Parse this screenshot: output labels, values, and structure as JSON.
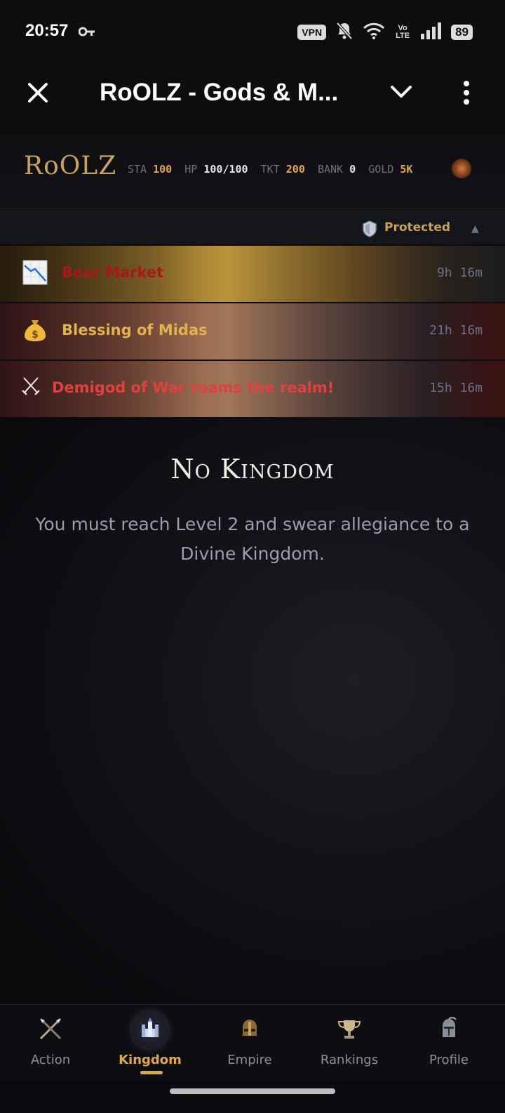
{
  "status_bar": {
    "time": "20:57",
    "vpn": "VPN",
    "network": "Vo LTE",
    "battery": "89"
  },
  "app_bar": {
    "title": "RoOLZ - Gods & M..."
  },
  "game_header": {
    "logo": "RoOLZ",
    "stats": [
      {
        "key": "STA",
        "value": "100"
      },
      {
        "key": "HP",
        "value": "100/100"
      },
      {
        "key": "TKT",
        "value": "200"
      },
      {
        "key": "BANK",
        "value": "0"
      },
      {
        "key": "GOLD",
        "value": "5K"
      }
    ]
  },
  "protection": {
    "label": "Protected",
    "caret": "▲"
  },
  "events": [
    {
      "icon": "chart-decreasing-icon",
      "title": "Bear Market",
      "time": "9h 16m"
    },
    {
      "icon": "money-bag-icon",
      "title": "Blessing of Midas",
      "time": "21h 16m"
    },
    {
      "icon": "crossed-swords-icon",
      "title": "Demigod of War roams the realm!",
      "time": "15h 16m"
    }
  ],
  "main": {
    "title": "No Kingdom",
    "description": "You must reach Level 2 and swear allegiance to a Divine Kingdom."
  },
  "nav": {
    "items": [
      {
        "label": "Action",
        "icon": "crossed-spears-icon"
      },
      {
        "label": "Kingdom",
        "icon": "castle-icon",
        "active": true
      },
      {
        "label": "Empire",
        "icon": "helmet-icon"
      },
      {
        "label": "Rankings",
        "icon": "trophy-icon"
      },
      {
        "label": "Profile",
        "icon": "knight-helmet-icon"
      }
    ]
  },
  "colors": {
    "accent_gold": "#e0a84a",
    "bear_red": "#a81818",
    "midas_gold": "#e1b24e",
    "war_red": "#e04040",
    "desc_text": "#9b9bb2"
  }
}
